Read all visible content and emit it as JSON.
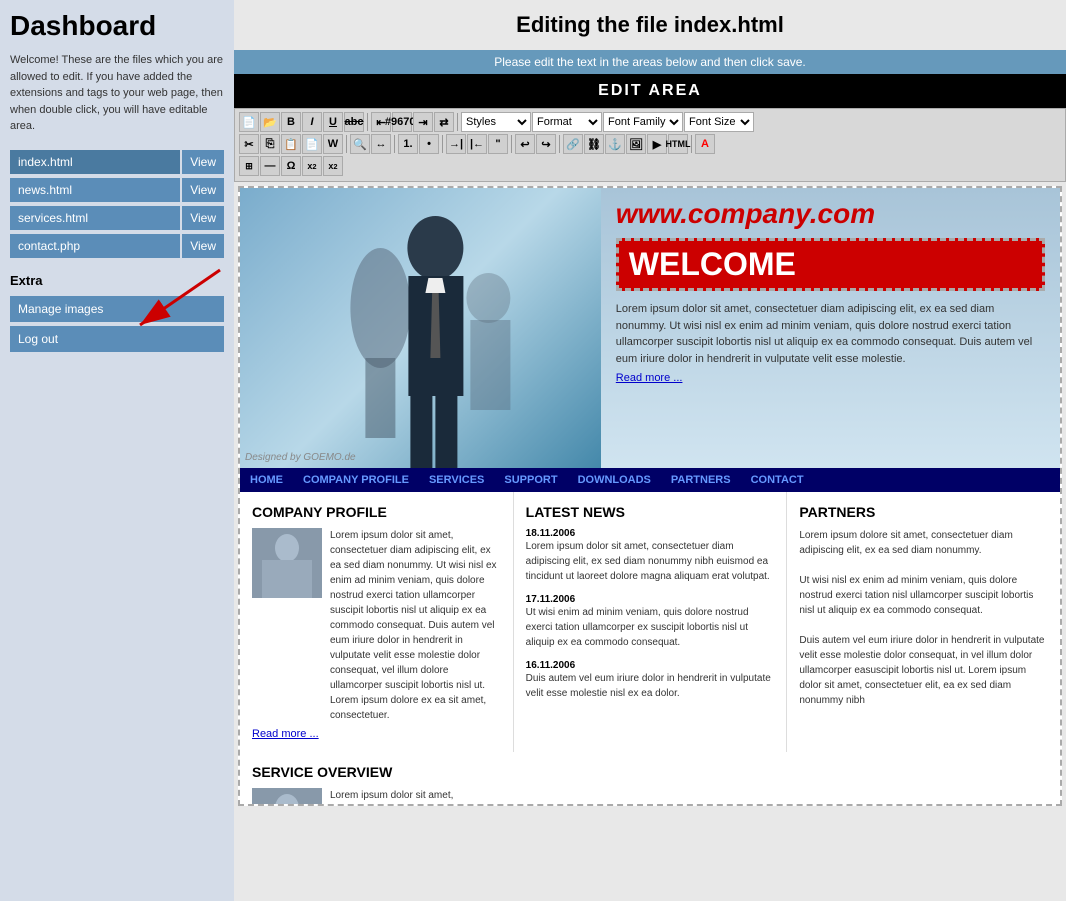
{
  "sidebar": {
    "title": "Dashboard",
    "intro": "Welcome! These are the files which you are allowed to edit. If you have added the extensions and tags to your web page, then when double click, you will have editable area.",
    "files": [
      {
        "name": "index.html",
        "active": true
      },
      {
        "name": "news.html",
        "active": false
      },
      {
        "name": "services.html",
        "active": false
      },
      {
        "name": "contact.php",
        "active": false
      }
    ],
    "view_label": "View",
    "extra_label": "Extra",
    "extra_buttons": [
      "Manage images",
      "Log out"
    ]
  },
  "main": {
    "page_title": "Editing the file index.html",
    "subtitle": "Please edit the text in the areas below and then click save.",
    "edit_area_label": "EDIT AREA",
    "toolbar": {
      "dropdowns": [
        "Styles",
        "Format",
        "Font Family",
        "Font Size"
      ]
    },
    "preview": {
      "company_url": "www.company.com",
      "welcome_text": "WELCOME",
      "designed_by": "Designed by GOEMO.de",
      "header_lorem": "Lorem ipsum dolor sit amet, consectetuer diam adipiscing elit, ex ea sed diam nonummy. Ut wisi nisl ex enim ad minim veniam, quis dolore nostrud exerci tation ullamcorper suscipit lobortis nisl ut aliquip ex ea commodo consequat. Duis autem vel eum iriure dolor in hendrerit in vulputate velit esse molestie.",
      "read_more_1": "Read more ...",
      "read_more_2": "Read more ...",
      "nav_items": [
        "HOME",
        "COMPANY PROFILE",
        "SERVICES",
        "SUPPORT",
        "DOWNLOADS",
        "PARTNERS",
        "CONTACT"
      ],
      "sections": [
        {
          "title": "COMPANY PROFILE",
          "text": "Lorem ipsum dolor sit amet, consectetuer diam adipiscing elit, ex ea sed diam nonummy. Ut wisi nisl ex enim ad minim veniam, quis dolore nostrud exerci tation ullamcorper suscipit lobortis nisl ut aliquip ex ea commodo consequat. Duis autem vel eum iriure dolor in hendrerit in vulputate velit esse molestie dolor consequat, vel illum dolore ullamcorper suscipit lobortis nisl ut. Lorem ipsum dolore ex ea sit amet, consectetuer.",
          "read_more": "Read more ..."
        },
        {
          "title": "LATEST NEWS",
          "news": [
            {
              "date": "18.11.2006",
              "text": "Lorem ipsum dolor sit amet, consectetuer diam adipiscing elit, ex sed diam nonummy nibh euismod ea tincidunt ut laoreet dolore magna aliquam erat volutpat."
            },
            {
              "date": "17.11.2006",
              "text": "Ut wisi enim ad minim veniam, quis dolore nostrud exerci tation ullamcorper ex suscipit lobortis nisl ut aliquip ex ea commodo consequat."
            },
            {
              "date": "16.11.2006",
              "text": "Duis autem vel eum iriure dolor in hendrerit in vulputate velit esse molestie nisl ex ea dolor."
            }
          ]
        },
        {
          "title": "PARTNERS",
          "text": "Lorem ipsum dolore sit amet, consectetuer diam adipiscing elit, ex ea sed diam nonummy.\n\nUt wisi nisl ex enim ad minim veniam, quis dolore nostrud exerci tation nisl ullamcorper suscipit lobortis nisl ut aliquip ex ea commodo consequat.\n\nDuis autem vel eum iriure dolor in hendrerit in vulputate velit esse molestie dolor consequat, in vel illum dolor ullamcorper easuscipit lobortis nisl ut. Lorem ipsum dolor sit amet, consectetuer elit, ea ex sed diam nonummy nibh"
        }
      ],
      "service_title": "SERVICE OVERVIEW",
      "service_text": "Lorem ipsum dolor sit amet, consectetuer elit, ex ea sed diam nonummy. Ut wisi nisl ex enim ad minim veniam,"
    }
  }
}
